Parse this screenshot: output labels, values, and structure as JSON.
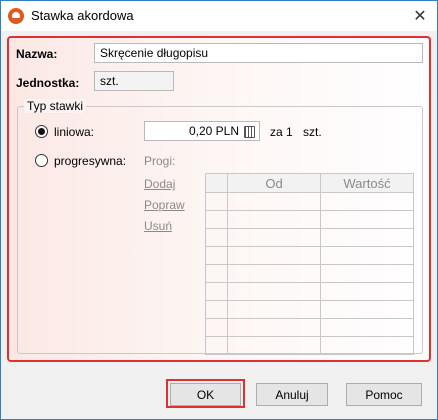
{
  "window": {
    "title": "Stawka akordowa",
    "close_glyph": "✕",
    "icon": "app-icon"
  },
  "form": {
    "name_label": "Nazwa:",
    "name_value": "Skręcenie długopisu",
    "unit_label": "Jednostka:",
    "unit_value": "szt."
  },
  "rate_type": {
    "group_label": "Typ stawki",
    "linear_label": "liniowa:",
    "linear_selected": true,
    "linear_value": "0,20 PLN",
    "per_text": "za 1",
    "per_unit": "szt.",
    "progressive_label": "progresywna:",
    "progressive_selected": false,
    "thresholds_label": "Progi:",
    "links": {
      "add": "Dodaj",
      "edit": "Popraw",
      "delete": "Usuń"
    },
    "table": {
      "columns": [
        "",
        "Od",
        "Wartość"
      ],
      "empty_rows": 9
    }
  },
  "footer": {
    "ok": "OK",
    "cancel": "Anuluj",
    "help": "Pomoc"
  },
  "colors": {
    "highlight": "#e03030",
    "window_border": "#2f7fc1"
  }
}
